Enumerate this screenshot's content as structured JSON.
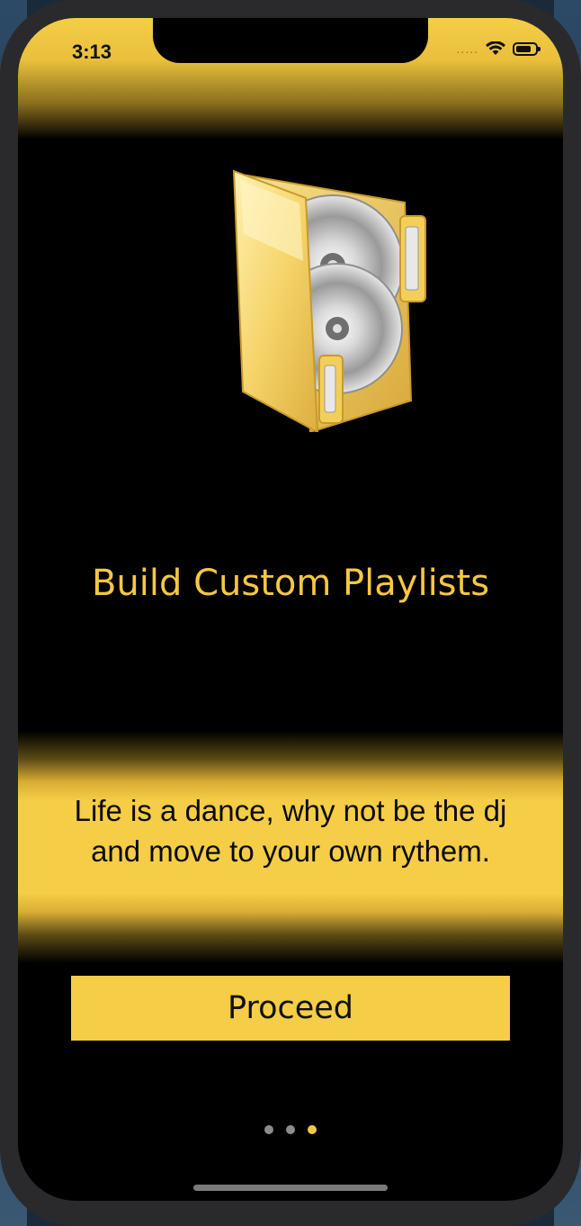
{
  "status_bar": {
    "time": "3:13",
    "signal_dots": "....."
  },
  "slide": {
    "icon": "folder-with-discs-icon",
    "title": "Build Custom Playlists",
    "description": "Life is a dance, why not be the dj and move to your own rythem."
  },
  "actions": {
    "proceed_label": "Proceed"
  },
  "pager": {
    "total_pages": 3,
    "active_page": 3
  },
  "colors": {
    "accent": "#f5cd46",
    "background": "#000000",
    "title_text": "#f5c842",
    "inactive_dot": "#8c8c8c"
  }
}
